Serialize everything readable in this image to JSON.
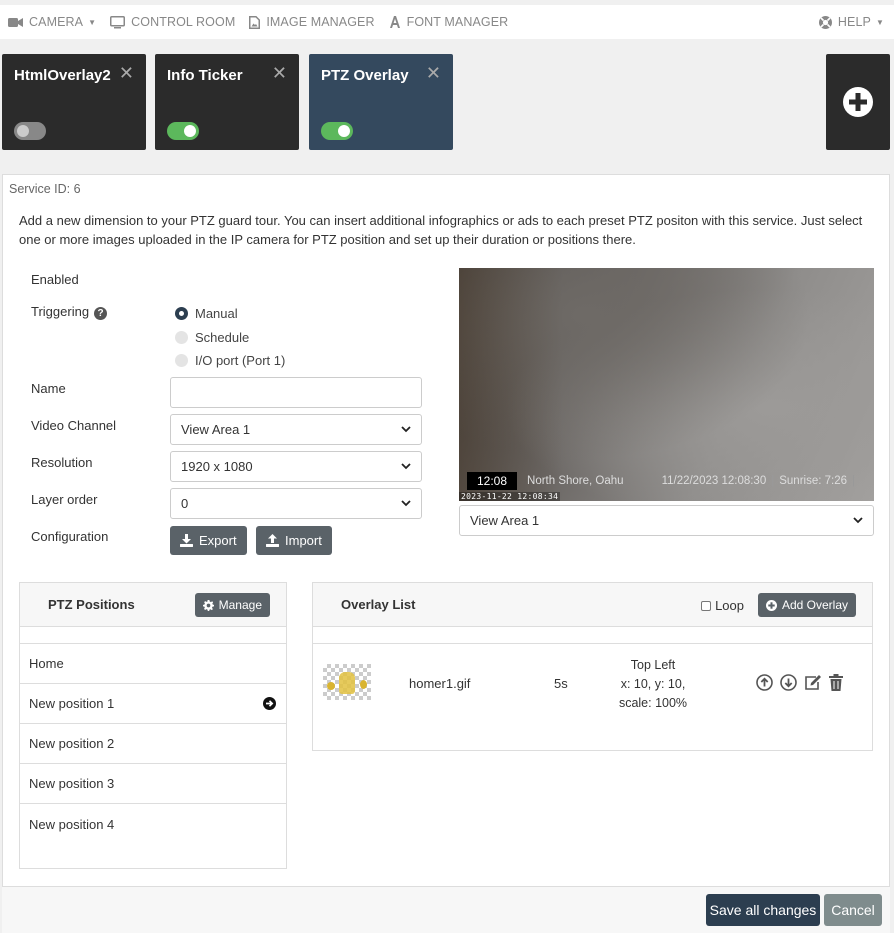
{
  "nav": {
    "camera": "CAMERA",
    "control_room": "CONTROL ROOM",
    "image_manager": "IMAGE MANAGER",
    "font_manager": "FONT MANAGER",
    "help": "HELP"
  },
  "tiles": [
    {
      "title": "HtmlOverlay2",
      "enabled": false
    },
    {
      "title": "Info Ticker",
      "enabled": true
    },
    {
      "title": "PTZ Overlay",
      "enabled": true,
      "active": true
    }
  ],
  "service": {
    "id_label": "Service ID: 6",
    "description": "Add a new dimension to your PTZ guard tour. You can insert additional infographics or ads to each preset PTZ positon with this service. Just select one or more images uploaded in the IP camera for PTZ position and set up their duration or positions there."
  },
  "form": {
    "enabled_label": "Enabled",
    "triggering_label": "Triggering",
    "triggering_options": [
      "Manual",
      "Schedule",
      "I/O port (Port 1)"
    ],
    "triggering_selected": "Manual",
    "name_label": "Name",
    "name_value": "",
    "video_channel_label": "Video Channel",
    "video_channel_value": "View Area 1",
    "resolution_label": "Resolution",
    "resolution_value": "1920 x 1080",
    "layer_order_label": "Layer order",
    "layer_order_value": "0",
    "configuration_label": "Configuration",
    "export_label": "Export",
    "import_label": "Import"
  },
  "preview": {
    "ticker_time": "12:08",
    "ticker_location": "North Shore, Oahu",
    "ticker_date": "11/22/2023  12:08:30",
    "ticker_sep": "|",
    "ticker_sunrise": "Sunrise: 7:26",
    "timestamp": "2023-11-22 12:08:34",
    "view_area_value": "View Area 1"
  },
  "ptz_positions": {
    "title": "PTZ Positions",
    "manage_label": "Manage",
    "items": [
      "Home",
      "New position 1",
      "New position 2",
      "New position 3",
      "New position 4"
    ],
    "selected_index": 1
  },
  "overlay_list": {
    "title": "Overlay List",
    "loop_label": "Loop",
    "add_label": "Add Overlay",
    "rows": [
      {
        "file": "homer1.gif",
        "duration": "5s",
        "position_name": "Top Left",
        "coords": "x: 10, y: 10,",
        "scale": "scale: 100%"
      }
    ]
  },
  "footer": {
    "save_label": "Save all changes",
    "cancel_label": "Cancel"
  },
  "colors": {
    "tile_dark": "#2b2b2b",
    "tile_active": "#34495e",
    "toggle_on": "#5cb85c",
    "button_dark": "#5a6268",
    "primary": "#2c3e50"
  }
}
